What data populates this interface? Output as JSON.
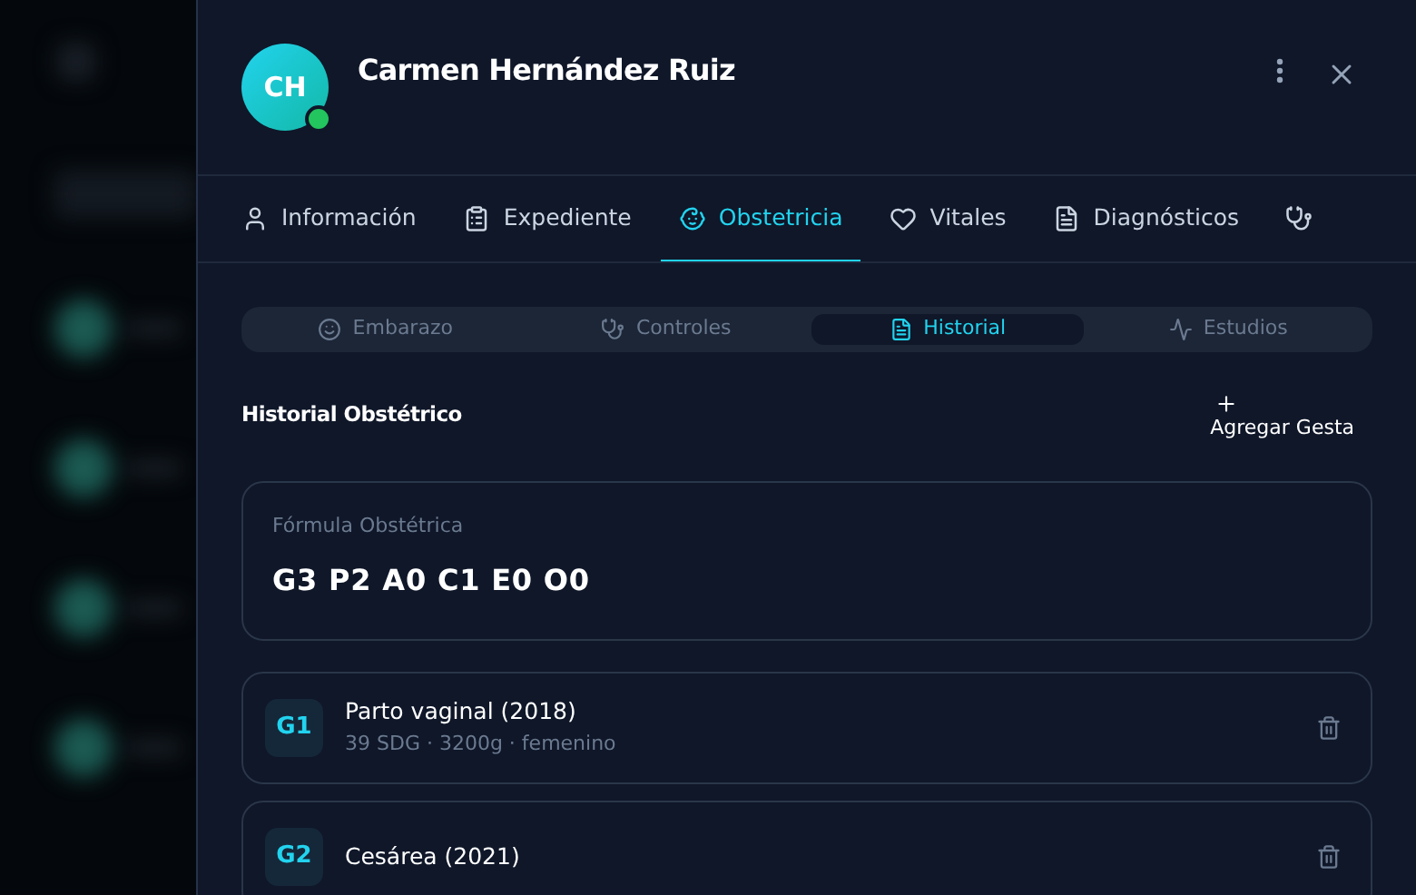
{
  "patient": {
    "initials": "CH",
    "name": "Carmen Hernández Ruiz",
    "online": true
  },
  "tabs": [
    {
      "label": "Información",
      "selected": false
    },
    {
      "label": "Expediente",
      "selected": false
    },
    {
      "label": "Obstetricia",
      "selected": true
    },
    {
      "label": "Vitales",
      "selected": false
    },
    {
      "label": "Diagnósticos",
      "selected": false
    },
    {
      "selected": false
    }
  ],
  "subtabs": [
    {
      "label": "Embarazo",
      "selected": false
    },
    {
      "label": "Controles",
      "selected": false
    },
    {
      "label": "Historial",
      "selected": true
    },
    {
      "label": "Estudios",
      "selected": false
    }
  ],
  "section": {
    "title": "Historial Obstétrico",
    "add_button": "Agregar Gesta"
  },
  "formula": {
    "label": "Fórmula Obstétrica",
    "value": "G3 P2 A0 C1 E0 O0"
  },
  "pregnancies": [
    {
      "badge": "G1",
      "title": "Parto vaginal (2018)",
      "details": "39 SDG · 3200g · femenino"
    },
    {
      "badge": "G2",
      "title": "Cesárea (2021)"
    }
  ]
}
